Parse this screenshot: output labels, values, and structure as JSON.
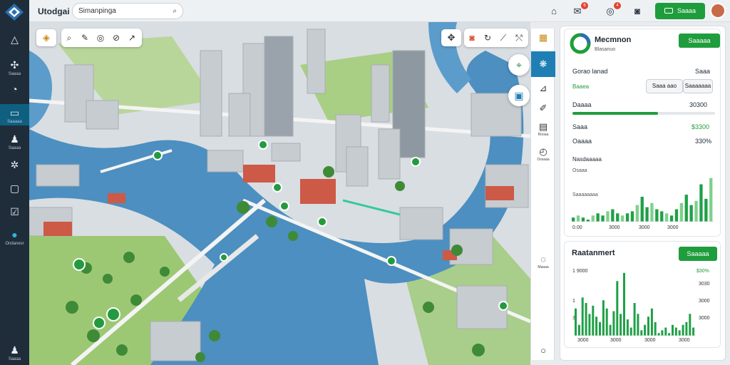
{
  "app": {
    "title": "Utodgai",
    "search_value": "Simanpinga"
  },
  "header_badges": {
    "messages": "6",
    "alerts": "4"
  },
  "header": {
    "dashboard_label": "Saaaa"
  },
  "sidebar": {
    "items": [
      {
        "icon": "home-icon",
        "label": ""
      },
      {
        "icon": "network-icon",
        "label": "Saaaa"
      },
      {
        "icon": "chat-icon",
        "label": ""
      },
      {
        "icon": "layers-icon",
        "label": "Saaaaa"
      },
      {
        "icon": "user-icon",
        "label": "Saaaa"
      },
      {
        "icon": "gear-icon",
        "label": ""
      },
      {
        "icon": "chart-icon",
        "label": ""
      },
      {
        "icon": "check-icon",
        "label": ""
      },
      {
        "icon": "globe-icon",
        "label": "Ondanesr"
      },
      {
        "icon": "person-icon",
        "label": "Saaaa"
      }
    ]
  },
  "map_strip": {
    "labels": {
      "layers": "Rooaa",
      "legend": "Ossaaa",
      "help": "Maaaa"
    }
  },
  "panel": {
    "title": "Mecmnon",
    "subtitle": "Blasanuo",
    "action_label": "Saaaaa",
    "row1": {
      "label": "Gorao lanad",
      "value": "Saaa"
    },
    "filter": {
      "label": "Baaea",
      "pill_a": "Saaa aao",
      "pill_b": "Saaaaaaa"
    },
    "progress": {
      "label": "Daaaa",
      "value": "30300",
      "fraction": 0.6
    },
    "stat_a": {
      "label": "Saaa",
      "value": "$3300"
    },
    "stat_b": {
      "label": "Oaaaa",
      "value": "330%"
    },
    "chart_title": "Nasdaaaaa",
    "chart_sub": "Osaaa",
    "legend_a": "Saaaaaaaa",
    "chart_ticks": [
      "0.00",
      "3000",
      "3000",
      "3000"
    ]
  },
  "panel2": {
    "title": "Raatanmert",
    "action_label": "Saaaaa",
    "ticks_left": [
      "1 9000",
      "1",
      "3"
    ],
    "ticks_right": [
      "$30%",
      "3030",
      "3000",
      "3000"
    ],
    "bottom_ticks": [
      "3000",
      "3000",
      "3000",
      "3000"
    ]
  },
  "chart_data": [
    {
      "type": "bar",
      "title": "Nasdaaaaa",
      "series": [
        {
          "name": "Saaaaaaaa",
          "values": [
            2,
            3,
            2,
            1,
            3,
            4,
            3,
            5,
            6,
            4,
            3,
            4,
            5,
            8,
            12,
            7,
            9,
            6,
            5,
            4,
            3,
            6,
            9,
            13,
            8,
            10,
            18,
            11,
            21
          ]
        }
      ],
      "ylim": [
        0,
        24
      ]
    },
    {
      "type": "bar",
      "title": "Raatanmert",
      "series": [
        {
          "name": "",
          "values": [
            10,
            4,
            14,
            12,
            8,
            11,
            7,
            5,
            13,
            10,
            4,
            9,
            20,
            8,
            23,
            6,
            3,
            12,
            8,
            2,
            4,
            7,
            10,
            5,
            1,
            2,
            3,
            1,
            4,
            3,
            2,
            4,
            5,
            8,
            3
          ]
        }
      ],
      "ylim": [
        0,
        24
      ]
    }
  ]
}
